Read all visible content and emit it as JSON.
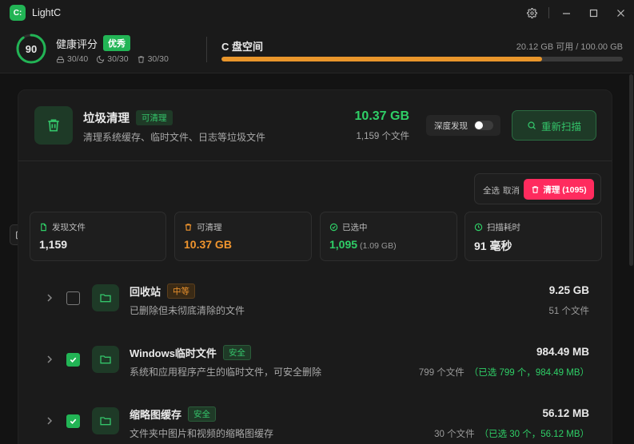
{
  "app": {
    "logo": "C:",
    "title": "LightC"
  },
  "window_controls": [
    "gear-icon",
    "minimize-icon",
    "maximize-icon",
    "close-icon"
  ],
  "health": {
    "score": "90",
    "score_percent": 90,
    "title": "健康评分",
    "badge": "优秀",
    "stats": [
      {
        "icon": "disk-icon",
        "value": "30/40"
      },
      {
        "icon": "moon-icon",
        "value": "30/30"
      },
      {
        "icon": "trash-icon",
        "value": "30/30"
      }
    ]
  },
  "disk": {
    "title": "C 盘空间",
    "info": "20.12 GB 可用 / 100.00 GB",
    "used_percent": 79.88
  },
  "cleaner": {
    "title": "垃圾清理",
    "badge": "可清理",
    "desc": "清理系统缓存、临时文件、日志等垃圾文件",
    "total_size": "10.37 GB",
    "total_count": "1,159 个文件",
    "deep_scan_label": "深度发现",
    "deep_scan_on": false,
    "rescan_label": "重新扫描"
  },
  "actions": {
    "select_all": "全选",
    "cancel": "取消",
    "clean_label": "清理 (1095)"
  },
  "stats": [
    {
      "label": "发现文件",
      "value": "1,159",
      "sub": "",
      "icon": "file-icon",
      "color": "#2fcf67"
    },
    {
      "label": "可清理",
      "value": "10.37 GB",
      "sub": "",
      "icon": "trash-icon",
      "color": "#f0952e"
    },
    {
      "label": "已选中",
      "value": "1,095",
      "sub": "(1.09 GB)",
      "icon": "check-circle-icon",
      "color": "#2fcf67"
    },
    {
      "label": "扫描耗时",
      "value": "91 毫秒",
      "sub": "",
      "icon": "clock-icon",
      "color": "#2fcf67"
    }
  ],
  "items": [
    {
      "title": "回收站",
      "badge": "中等",
      "badge_type": "orange",
      "desc": "已删除但未彻底清除的文件",
      "size": "9.25 GB",
      "count": "51 个文件",
      "selected_text": "",
      "checked": false
    },
    {
      "title": "Windows临时文件",
      "badge": "安全",
      "badge_type": "safe",
      "desc": "系统和应用程序产生的临时文件，可安全删除",
      "size": "984.49 MB",
      "count": "799 个文件",
      "selected_text": "（已选 799 个，984.49 MB）",
      "checked": true
    },
    {
      "title": "缩略图缓存",
      "badge": "安全",
      "badge_type": "safe",
      "desc": "文件夹中图片和视频的缩略图缓存",
      "size": "56.12 MB",
      "count": "30 个文件",
      "selected_text": "（已选 30 个，56.12 MB）",
      "checked": true
    }
  ]
}
